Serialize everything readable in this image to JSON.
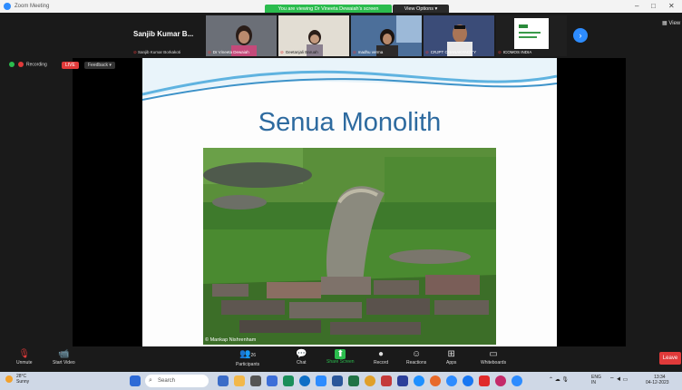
{
  "window": {
    "title": "Zoom Meeting",
    "controls": [
      "–",
      "□",
      "✕"
    ]
  },
  "banner": {
    "text": "You are viewing Dr Vineeta Dewaiah's screen",
    "view_options": "View Options ▾"
  },
  "participants": {
    "speaker_name": "Sanjib Kumar B...",
    "speaker_caption": "Sanjib Kumar Borkakoti",
    "thumbs": [
      {
        "name": "Dr Vineeta Dewaiah"
      },
      {
        "name": "Geetanjali Baruah"
      },
      {
        "name": "madhu verma"
      },
      {
        "name": "CRJPT CHANAKYACITY"
      },
      {
        "name": "ICOMOS INDIA"
      }
    ],
    "next_label": "›",
    "view_label": "View"
  },
  "status": {
    "recording": "Recording",
    "live": "LIVE",
    "feedback": "Feedback ▾"
  },
  "slide": {
    "title": "Senua Monolith",
    "credit": "© Mankap Nishrenham"
  },
  "toolbar": [
    {
      "label": "Unmute",
      "icon": "mic-off-icon",
      "glyph": "🎙"
    },
    {
      "label": "Start Video",
      "icon": "video-off-icon",
      "glyph": "📹"
    },
    {
      "label": "Participants",
      "icon": "participants-icon",
      "glyph": "👥",
      "count": "26"
    },
    {
      "label": "Chat",
      "icon": "chat-icon",
      "glyph": "💬"
    },
    {
      "label": "Share Screen",
      "icon": "share-screen-icon",
      "glyph": "⬆"
    },
    {
      "label": "Record",
      "icon": "record-icon",
      "glyph": "●"
    },
    {
      "label": "Reactions",
      "icon": "reactions-icon",
      "glyph": "☺"
    },
    {
      "label": "Apps",
      "icon": "apps-icon",
      "glyph": "⊞"
    },
    {
      "label": "Whiteboards",
      "icon": "whiteboard-icon",
      "glyph": "▭"
    }
  ],
  "leave": "Leave",
  "taskbar": {
    "weather_temp": "28°C",
    "weather_desc": "Sunny",
    "search": "Search",
    "lang": "ENG",
    "region": "IN",
    "time": "13:34",
    "date": "04-12-2023"
  },
  "colors": {
    "zoom_blue": "#2d8cff",
    "banner_green": "#2bbc4e",
    "leave_red": "#e03a3a",
    "title_blue": "#2d6a9f"
  }
}
